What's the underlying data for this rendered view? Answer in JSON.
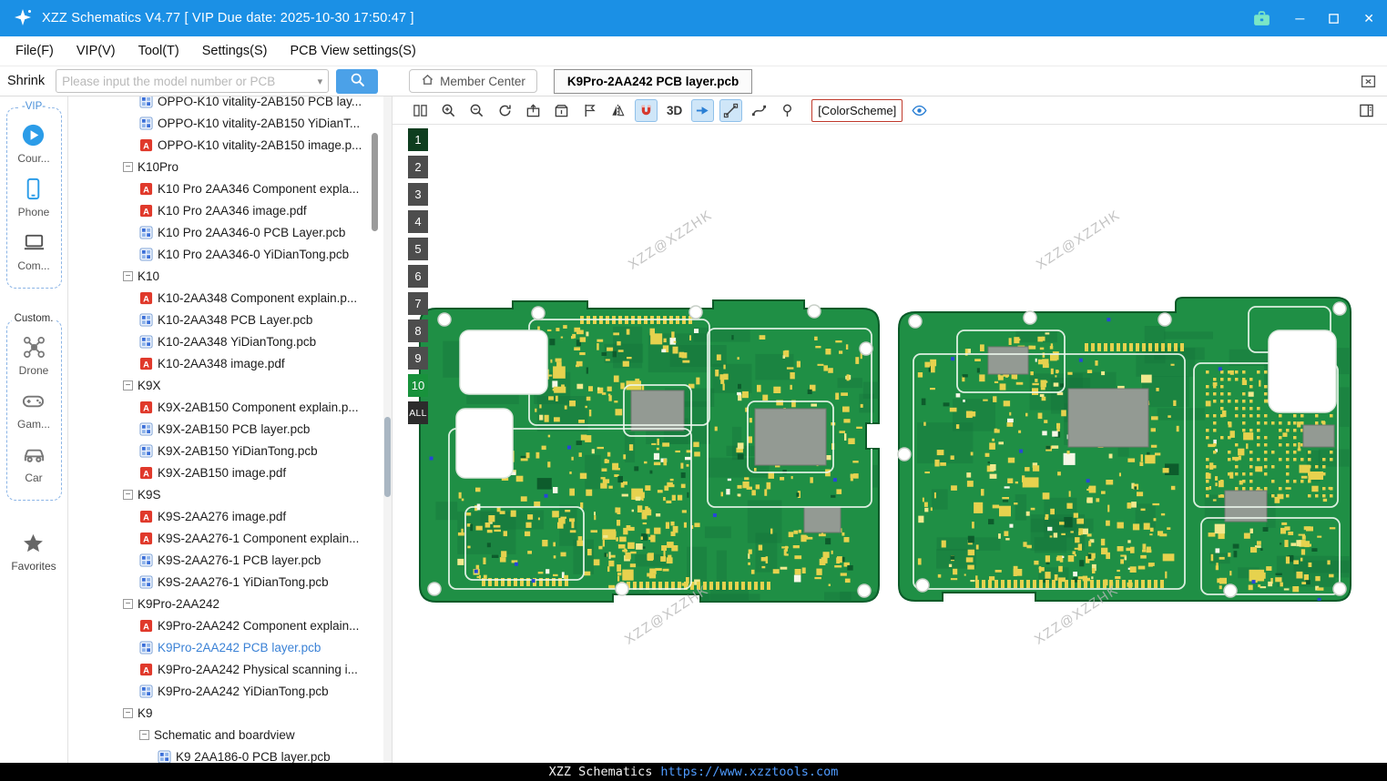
{
  "titlebar": {
    "title": "XZZ Schematics V4.77 [ VIP Due date: 2025-10-30 17:50:47 ]",
    "minimize_glyph": "─",
    "close_glyph": "✕"
  },
  "menu": {
    "items": [
      {
        "key": "file",
        "label": "File(F)"
      },
      {
        "key": "vip",
        "label": "VIP(V)"
      },
      {
        "key": "tool",
        "label": "Tool(T)"
      },
      {
        "key": "settings",
        "label": "Settings(S)"
      },
      {
        "key": "pcb-view-settings",
        "label": "PCB View settings(S)"
      }
    ]
  },
  "toolbar": {
    "shrink_label": "Shrink",
    "search_placeholder": "Please input the model number or PCB",
    "chevron_glyph": "▾",
    "member_center_label": "Member Center",
    "tab_title": "K9Pro-2AA242 PCB layer.pcb"
  },
  "sidebar": {
    "groups": [
      {
        "label": "-VIP-",
        "accent": "#4a90d9",
        "items": [
          {
            "icon": "course-play-icon",
            "label": "Cour..."
          },
          {
            "icon": "phone-icon",
            "label": "Phone"
          },
          {
            "icon": "computer-icon",
            "label": "Com..."
          }
        ]
      },
      {
        "label": "Custom.",
        "accent": "#333333",
        "items": [
          {
            "icon": "drone-icon",
            "label": "Drone"
          },
          {
            "icon": "gamepad-icon",
            "label": "Gam..."
          },
          {
            "icon": "car-icon",
            "label": "Car"
          }
        ]
      }
    ],
    "favorites": {
      "icon": "star-icon",
      "label": "Favorites"
    }
  },
  "tree": {
    "expander_glyph": "−",
    "items": [
      {
        "label": "OPPO-K10 vitality-2AB150 PCB lay...",
        "type": "pcb",
        "indent": 1
      },
      {
        "label": "OPPO-K10 vitality-2AB150 YiDianT...",
        "type": "pcb",
        "indent": 1
      },
      {
        "label": "OPPO-K10 vitality-2AB150 image.p...",
        "type": "pdf",
        "indent": 1
      },
      {
        "label": "K10Pro",
        "type": "node",
        "indent": 0
      },
      {
        "label": "K10 Pro 2AA346 Component expla...",
        "type": "pdf",
        "indent": 1
      },
      {
        "label": "K10 Pro 2AA346 image.pdf",
        "type": "pdf",
        "indent": 1
      },
      {
        "label": "K10 Pro 2AA346-0 PCB Layer.pcb",
        "type": "pcb",
        "indent": 1
      },
      {
        "label": "K10 Pro 2AA346-0 YiDianTong.pcb",
        "type": "pcb",
        "indent": 1
      },
      {
        "label": "K10",
        "type": "node",
        "indent": 0
      },
      {
        "label": "K10-2AA348 Component explain.p...",
        "type": "pdf",
        "indent": 1
      },
      {
        "label": "K10-2AA348 PCB Layer.pcb",
        "type": "pcb",
        "indent": 1
      },
      {
        "label": "K10-2AA348 YiDianTong.pcb",
        "type": "pcb",
        "indent": 1
      },
      {
        "label": "K10-2AA348 image.pdf",
        "type": "pdf",
        "indent": 1
      },
      {
        "label": "K9X",
        "type": "node",
        "indent": 0
      },
      {
        "label": "K9X-2AB150 Component explain.p...",
        "type": "pdf",
        "indent": 1
      },
      {
        "label": "K9X-2AB150 PCB layer.pcb",
        "type": "pcb",
        "indent": 1
      },
      {
        "label": "K9X-2AB150 YiDianTong.pcb",
        "type": "pcb",
        "indent": 1
      },
      {
        "label": "K9X-2AB150 image.pdf",
        "type": "pdf",
        "indent": 1
      },
      {
        "label": "K9S",
        "type": "node",
        "indent": 0
      },
      {
        "label": "K9S-2AA276 image.pdf",
        "type": "pdf",
        "indent": 1
      },
      {
        "label": "K9S-2AA276-1 Component explain...",
        "type": "pdf",
        "indent": 1
      },
      {
        "label": "K9S-2AA276-1 PCB layer.pcb",
        "type": "pcb",
        "indent": 1
      },
      {
        "label": "K9S-2AA276-1 YiDianTong.pcb",
        "type": "pcb",
        "indent": 1
      },
      {
        "label": "K9Pro-2AA242",
        "type": "node",
        "indent": 0
      },
      {
        "label": "K9Pro-2AA242 Component explain...",
        "type": "pdf",
        "indent": 1
      },
      {
        "label": "K9Pro-2AA242 PCB layer.pcb",
        "type": "pcb",
        "indent": 1,
        "selected": true
      },
      {
        "label": "K9Pro-2AA242 Physical scanning i...",
        "type": "pdf",
        "indent": 1
      },
      {
        "label": "K9Pro-2AA242 YiDianTong.pcb",
        "type": "pcb",
        "indent": 1
      },
      {
        "label": "K9",
        "type": "node",
        "indent": 0
      },
      {
        "label": "Schematic and boardview",
        "type": "node",
        "indent": 1
      },
      {
        "label": "K9 2AA186-0 PCB layer.pcb",
        "type": "pcb",
        "indent": 2
      }
    ]
  },
  "pcb_toolbar": {
    "buttons": [
      {
        "icon": "split-view-icon"
      },
      {
        "icon": "zoom-in-icon"
      },
      {
        "icon": "zoom-out-icon"
      },
      {
        "icon": "refresh-icon"
      },
      {
        "icon": "export-box-icon"
      },
      {
        "icon": "open-box-icon"
      },
      {
        "icon": "flag-icon"
      },
      {
        "icon": "mirror-flip-icon"
      },
      {
        "icon": "magnet-icon",
        "selected": true
      },
      {
        "icon": "3d-button",
        "label": "3D"
      },
      {
        "icon": "jump-arrow-icon",
        "selected": true
      },
      {
        "icon": "measure-icon",
        "selected": true
      },
      {
        "icon": "curve-icon"
      },
      {
        "icon": "probe-pin-icon"
      },
      {
        "icon": "colorscheme-button",
        "label": "[ColorScheme]"
      },
      {
        "icon": "visibility-eye-icon"
      }
    ],
    "right_button": {
      "icon": "layers-panel-icon"
    }
  },
  "layers": {
    "items": [
      {
        "label": "1",
        "state": "dark"
      },
      {
        "label": "2",
        "state": "normal"
      },
      {
        "label": "3",
        "state": "normal"
      },
      {
        "label": "4",
        "state": "normal"
      },
      {
        "label": "5",
        "state": "normal"
      },
      {
        "label": "6",
        "state": "normal"
      },
      {
        "label": "7",
        "state": "normal"
      },
      {
        "label": "8",
        "state": "normal"
      },
      {
        "label": "9",
        "state": "normal"
      },
      {
        "label": "10",
        "state": "active"
      },
      {
        "label": "ALL",
        "state": "all"
      }
    ]
  },
  "canvas": {
    "watermark": "XZZ@XZZHK"
  },
  "statusbar": {
    "brand": "XZZ Schematics",
    "url": "https://www.xzztools.com"
  },
  "colors": {
    "titlebar_blue": "#1b90e5",
    "pcb_green": "#1f8f45",
    "component_yellow": "#e6d24e",
    "active_layer_green": "#18923c",
    "selected_item_blue": "#3b82d6",
    "colorscheme_border_red": "#c0392b"
  }
}
